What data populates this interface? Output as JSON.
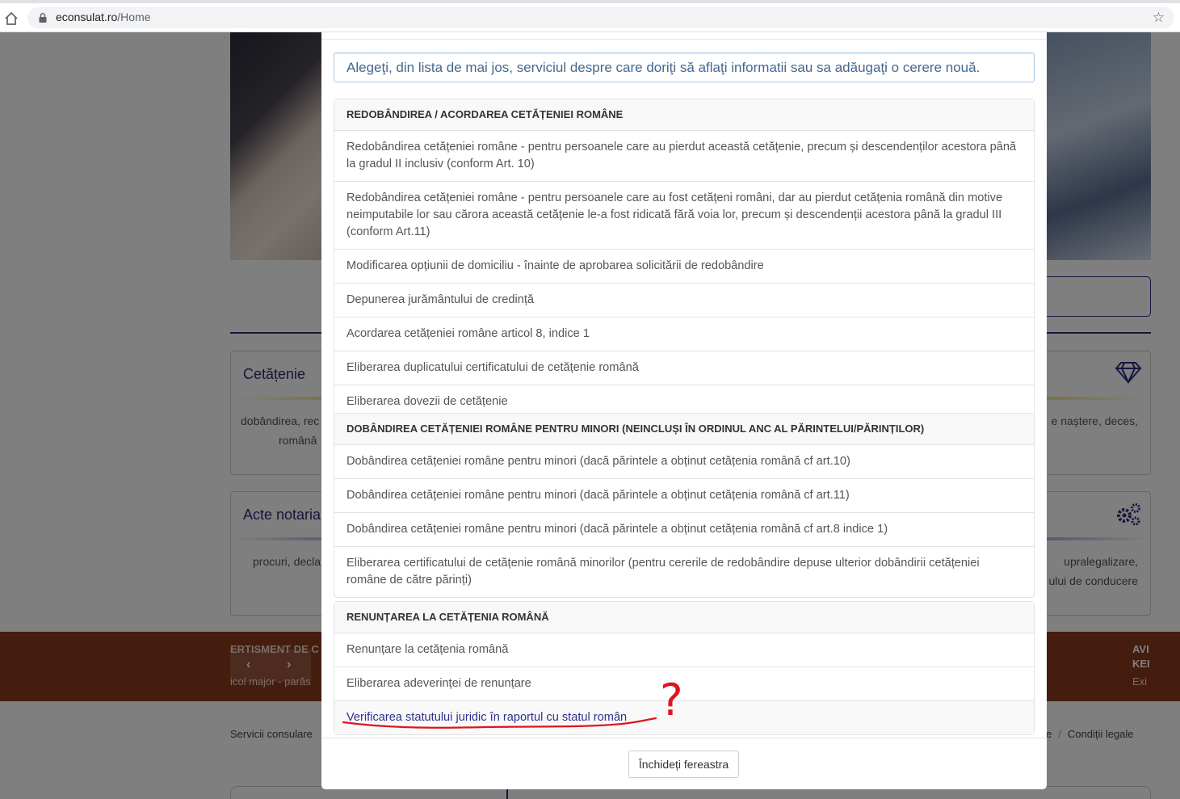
{
  "browser": {
    "url_domain": "econsulat.ro",
    "url_path": "/Home"
  },
  "background": {
    "card_1_title": "Cetățenie",
    "card_1_text_a": "dobândirea, rec",
    "card_1_text_b": "română",
    "card_2_title": "Acte notaria",
    "card_2_text": "procuri, decla",
    "card_3_text": "e naștere, deces,",
    "card_4_text_a": "upralegalizare,",
    "card_4_text_b": "ului de conducere",
    "banner_title": "ERTISMENT DE C",
    "banner_text": "icol major - parăs",
    "banner_nav_prev": "‹",
    "banner_nav_next": "›",
    "banner_right_1": "AVI",
    "banner_right_2": "KEI",
    "banner_right_3": "Exi",
    "footer_left": "Servicii consulare",
    "footer_right_a": "e",
    "footer_right_sep": "/",
    "footer_right_b": "Condiții legale"
  },
  "modal": {
    "intro_text": "Alegeţi, din lista de mai jos, serviciul despre care doriţi să aflaţi informatii sau sa adăugaţi o cerere nouă.",
    "sections": [
      {
        "heading": "REDOBÂNDIREA / ACORDAREA CETĂȚENIEI ROMÂNE",
        "items": [
          "Redobândirea cetățeniei române - pentru persoanele care au pierdut această cetățenie, precum și descendenților acestora până la gradul II inclusiv (conform Art. 10)",
          "Redobândirea cetățeniei române - pentru persoanele care au fost cetățeni români, dar au pierdut cetățenia română din motive neimputabile lor sau cărora această cetățenie le-a fost ridicată fără voia lor, precum și descendenții acestora până la gradul III (conform Art.11)",
          "Modificarea opțiunii de domiciliu - înainte de aprobarea solicitării de redobândire",
          "Depunerea jurământului de credință",
          "Acordarea cetățeniei române articol 8, indice 1",
          "Eliberarea duplicatului certificatului de cetățenie română",
          "Eliberarea dovezii de cetățenie"
        ]
      },
      {
        "heading": "DOBÂNDIREA CETĂȚENIEI ROMÂNE PENTRU MINORI (NEINCLUȘI ÎN ORDINUL ANC AL PĂRINTELUI/PĂRINȚILOR)",
        "items": [
          "Dobândirea cetățeniei române pentru minori (dacă părintele a obținut cetățenia română cf art.10)",
          "Dobândirea cetățeniei române pentru minori (dacă părintele a obținut cetățenia română cf art.11)",
          "Dobândirea cetățeniei române pentru minori (dacă părintele a obținut cetățenia română cf art.8 indice 1)",
          "Eliberarea certificatului de cetățenie română minorilor (pentru cererile de redobândire depuse ulterior dobândirii cetățeniei române de către părinți)"
        ]
      },
      {
        "heading": "RENUNȚAREA LA CETĂȚENIA ROMÂNĂ",
        "items": [
          "Renunțare la cetățenia română",
          "Eliberarea adeverinței de renunțare",
          "Verificarea statutului juridic în raportul cu statul român"
        ]
      }
    ],
    "close_label": "Închideți fereastra"
  },
  "annotation": {
    "mark": "?",
    "color": "#e0141e"
  },
  "colors": {
    "brand": "#2d2a7a",
    "banner": "#8b3a1e",
    "highlight_link": "#2f2f8f"
  }
}
